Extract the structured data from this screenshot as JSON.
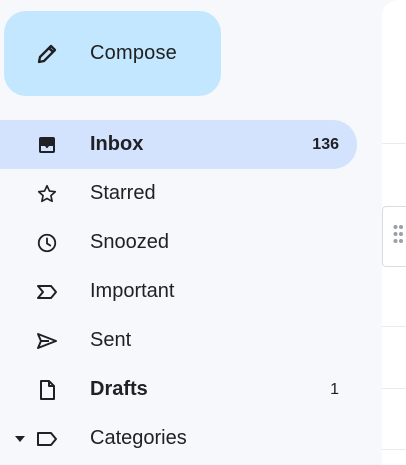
{
  "compose": {
    "label": "Compose",
    "icon": "pencil-icon"
  },
  "nav": {
    "items": [
      {
        "id": "inbox",
        "label": "Inbox",
        "count": "136",
        "icon": "inbox-icon",
        "active": true,
        "bold": true
      },
      {
        "id": "starred",
        "label": "Starred",
        "count": "",
        "icon": "star-icon",
        "active": false,
        "bold": false
      },
      {
        "id": "snoozed",
        "label": "Snoozed",
        "count": "",
        "icon": "clock-icon",
        "active": false,
        "bold": false
      },
      {
        "id": "important",
        "label": "Important",
        "count": "",
        "icon": "label-important-icon",
        "active": false,
        "bold": false
      },
      {
        "id": "sent",
        "label": "Sent",
        "count": "",
        "icon": "send-icon",
        "active": false,
        "bold": false
      },
      {
        "id": "drafts",
        "label": "Drafts",
        "count": "1",
        "icon": "draft-file-icon",
        "active": false,
        "bold": true
      },
      {
        "id": "categories",
        "label": "Categories",
        "count": "",
        "icon": "label-icon",
        "active": false,
        "bold": false,
        "expand_icon": "caret-down-icon"
      }
    ]
  },
  "colors": {
    "background": "#f6f8fc",
    "compose_bg": "#c2e7ff",
    "active_bg": "#d3e3fd",
    "text": "#202124",
    "panel": "#ffffff"
  }
}
